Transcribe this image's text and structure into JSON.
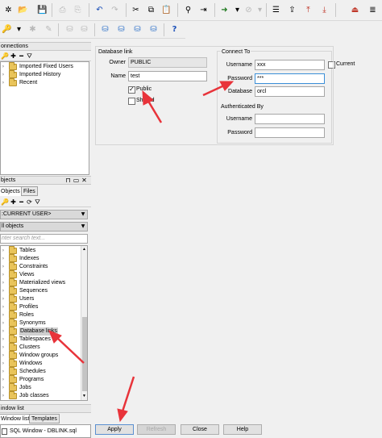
{
  "connections": {
    "header": "onnections",
    "tree": [
      "Imported Fixed Users",
      "Imported History",
      "Recent"
    ]
  },
  "objects": {
    "header": "bjects",
    "tabs": [
      "Objects",
      "Files"
    ],
    "user_combo": ":CURRENT USER>",
    "filter_combo": "ll objects",
    "search_placeholder": "nter search text...",
    "tree": [
      "Tables",
      "Indexes",
      "Constraints",
      "Views",
      "Materialized views",
      "Sequences",
      "Users",
      "Profiles",
      "Roles",
      "Synonyms",
      "Database links",
      "Tablespaces",
      "Clusters",
      "Window groups",
      "Windows",
      "Schedules",
      "Programs",
      "Jobs",
      "Job classes"
    ],
    "selected_item": "Database links"
  },
  "window_list": {
    "header": "indow list",
    "tabs": [
      "Window list",
      "Templates"
    ],
    "items": [
      "SQL Window - DBLINK.sql"
    ]
  },
  "db_link": {
    "group_title": "Database link",
    "owner_label": "Owner",
    "owner_value": "PUBLIC",
    "name_label": "Name",
    "name_value": "test",
    "public_label": "Public",
    "public_checked": true,
    "shared_label": "Shared",
    "shared_checked": false
  },
  "connect_to": {
    "group_title": "Connect To",
    "username_label": "Username",
    "username_value": "xxx",
    "current_label": "Current",
    "current_checked": false,
    "password_label": "Password",
    "password_value": "***",
    "database_label": "Database",
    "database_value": "orcl"
  },
  "authenticated_by": {
    "group_title": "Authenticated By",
    "username_label": "Username",
    "username_value": "",
    "password_label": "Password",
    "password_value": ""
  },
  "buttons": {
    "apply": "Apply",
    "refresh": "Refresh",
    "close": "Close",
    "help": "Help"
  },
  "colors": {
    "annotation_arrow": "#e8333a",
    "folder": "#e9c45a",
    "focus_border": "#3b8fd8"
  }
}
